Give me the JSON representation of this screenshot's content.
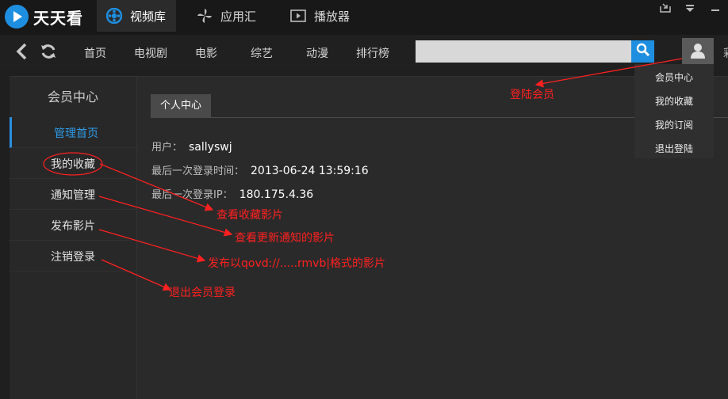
{
  "app": {
    "title": "天天看"
  },
  "main_tabs": [
    {
      "label": "视频库",
      "icon": "video-library-icon",
      "active": true
    },
    {
      "label": "应用汇",
      "icon": "pinwheel-icon",
      "active": false
    },
    {
      "label": "播放器",
      "icon": "player-icon",
      "active": false
    }
  ],
  "nav": {
    "links": [
      "首页",
      "电视剧",
      "电影",
      "综艺",
      "动漫",
      "排行榜"
    ],
    "search_placeholder": "",
    "edge_text": "彩"
  },
  "sidebar": {
    "title": "会员中心",
    "items": [
      {
        "label": "管理首页",
        "active": true
      },
      {
        "label": "我的收藏",
        "active": false
      },
      {
        "label": "通知管理",
        "active": false
      },
      {
        "label": "发布影片",
        "active": false
      },
      {
        "label": "注销登录",
        "active": false
      }
    ]
  },
  "main": {
    "tab": "个人中心",
    "user": {
      "label": "用户：",
      "value": "sallyswj"
    },
    "last_login_time": {
      "label": "最后一次登录时间：",
      "value": "2013-06-24 13:59:16"
    },
    "last_login_ip": {
      "label": "最后一次登录IP：",
      "value": "180.175.4.36"
    }
  },
  "user_menu": [
    "会员中心",
    "我的收藏",
    "我的订阅",
    "退出登陆"
  ],
  "annotations": {
    "login": "登陆会员",
    "favorites": "查看收藏影片",
    "notifications": "查看更新通知的影片",
    "publish": "发布以qovd://.....rmvb|格式的影片",
    "logout": "退出会员登录"
  },
  "colors": {
    "accent": "#1e8fe0",
    "annotation": "#ff2020"
  }
}
